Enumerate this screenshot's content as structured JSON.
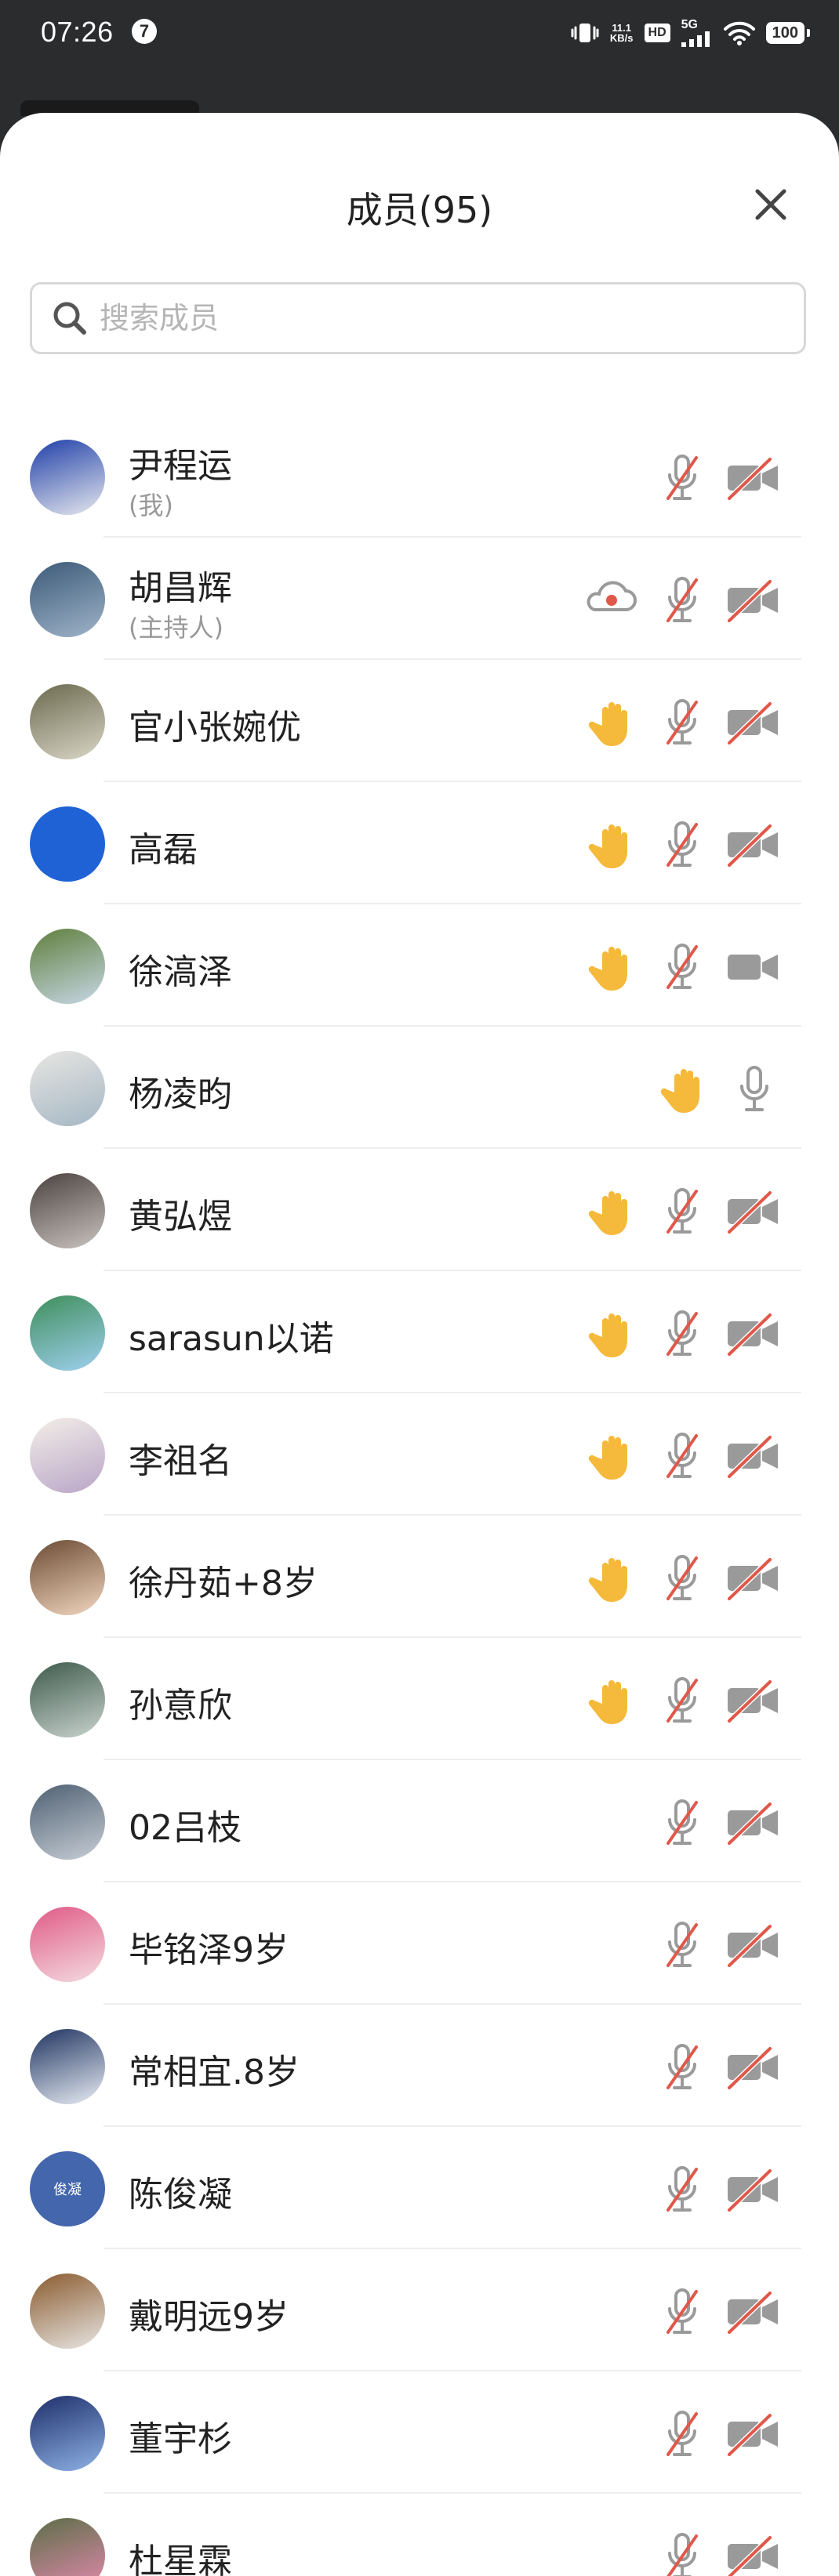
{
  "status_bar": {
    "time": "07:26",
    "notification_badge": "7",
    "net_speed_value": "11.1",
    "net_speed_unit": "KB/s",
    "hd": "HD",
    "network": "5G",
    "battery": "100"
  },
  "header": {
    "title": "成员(95)"
  },
  "search": {
    "placeholder": "搜索成员"
  },
  "colors": {
    "hand": "#F5B93B",
    "muted_slash": "#E0584A",
    "icon_gray": "#9A9A9A"
  },
  "members": [
    {
      "name": "尹程运",
      "sub": "(我)",
      "hand": false,
      "recording": false,
      "mic": "muted",
      "camera": "off",
      "avatar": [
        "#1F3FA8",
        "#E6E8EE"
      ]
    },
    {
      "name": "胡昌辉",
      "sub": "(主持人)",
      "hand": false,
      "recording": true,
      "mic": "muted",
      "camera": "off",
      "avatar": [
        "#3C5A78",
        "#9FB4C9"
      ]
    },
    {
      "name": "官小张婉优",
      "sub": "",
      "hand": true,
      "recording": false,
      "mic": "muted",
      "camera": "off",
      "avatar": [
        "#6B6A4E",
        "#D9D6C6"
      ]
    },
    {
      "name": "高磊",
      "sub": "",
      "hand": true,
      "recording": false,
      "mic": "muted",
      "camera": "off",
      "avatar": [
        "#1E62D6",
        "#1E62D6"
      ]
    },
    {
      "name": "徐滈泽",
      "sub": "",
      "hand": true,
      "recording": false,
      "mic": "muted",
      "camera": "on",
      "avatar": [
        "#5E7F3C",
        "#C8D7E6"
      ]
    },
    {
      "name": "杨凌昀",
      "sub": "",
      "hand": true,
      "recording": false,
      "mic": "on",
      "camera": "none",
      "avatar": [
        "#E8E6E2",
        "#A4B7C4"
      ]
    },
    {
      "name": "黄弘煜",
      "sub": "",
      "hand": true,
      "recording": false,
      "mic": "muted",
      "camera": "off",
      "avatar": [
        "#4A4240",
        "#C9C3BF"
      ]
    },
    {
      "name": " sarasun以诺",
      "sub": "",
      "hand": true,
      "recording": false,
      "mic": "muted",
      "camera": "off",
      "avatar": [
        "#3E8E5A",
        "#9FD0F0"
      ]
    },
    {
      "name": "李祖名",
      "sub": "",
      "hand": true,
      "recording": false,
      "mic": "muted",
      "camera": "off",
      "avatar": [
        "#F3EEE8",
        "#B9A5C7"
      ]
    },
    {
      "name": "徐丹茹+8岁",
      "sub": "",
      "hand": true,
      "recording": false,
      "mic": "muted",
      "camera": "off",
      "avatar": [
        "#6B4A32",
        "#F2D7C0"
      ]
    },
    {
      "name": "孙意欣",
      "sub": "",
      "hand": true,
      "recording": false,
      "mic": "muted",
      "camera": "off",
      "avatar": [
        "#3E5A4C",
        "#C9D3CE"
      ]
    },
    {
      "name": "02吕枝",
      "sub": "",
      "hand": false,
      "recording": false,
      "mic": "muted",
      "camera": "off",
      "avatar": [
        "#4F6072",
        "#C7CED6"
      ]
    },
    {
      "name": "毕铭泽9岁",
      "sub": "",
      "hand": false,
      "recording": false,
      "mic": "muted",
      "camera": "off",
      "avatar": [
        "#E05A86",
        "#F4DCE2"
      ]
    },
    {
      "name": "常相宜.8岁",
      "sub": "",
      "hand": false,
      "recording": false,
      "mic": "muted",
      "camera": "off",
      "avatar": [
        "#1E3360",
        "#E9EDF4"
      ]
    },
    {
      "name": "陈俊凝",
      "sub": "",
      "hand": false,
      "recording": false,
      "mic": "muted",
      "camera": "off",
      "avatar": [
        "#4466AD",
        "#4466AD"
      ],
      "avatar_text": "俊凝"
    },
    {
      "name": "戴明远9岁",
      "sub": "",
      "hand": false,
      "recording": false,
      "mic": "muted",
      "camera": "off",
      "avatar": [
        "#8A5A2E",
        "#E8E6E3"
      ]
    },
    {
      "name": "董宇杉",
      "sub": "",
      "hand": false,
      "recording": false,
      "mic": "muted",
      "camera": "off",
      "avatar": [
        "#1E2E6A",
        "#8EB2E6"
      ]
    },
    {
      "name": "杜星霖",
      "sub": "",
      "hand": false,
      "recording": false,
      "mic": "muted",
      "camera": "off",
      "avatar": [
        "#5A6E46",
        "#E78AB1"
      ]
    }
  ]
}
